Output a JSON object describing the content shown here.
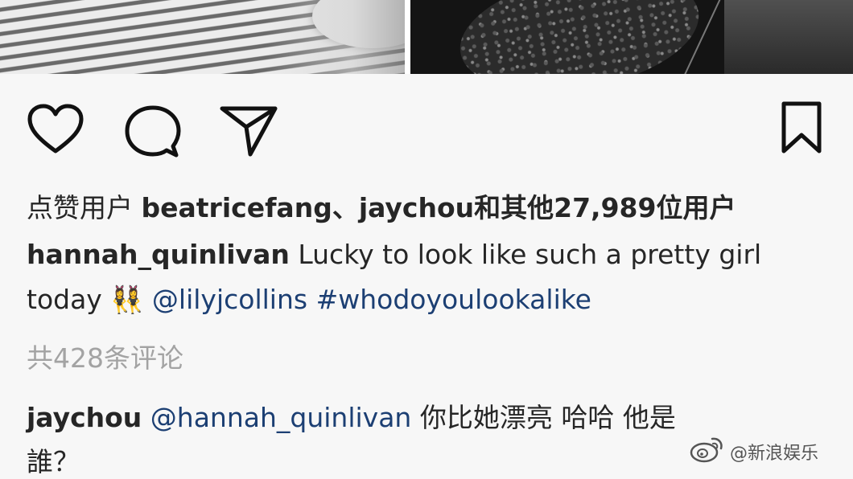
{
  "post": {
    "likes_line": {
      "prefix": "点赞用户",
      "users": "beatricefang、jaychou",
      "suffix": "和其他27,989位用户"
    },
    "caption": {
      "username": "hannah_quinlivan",
      "text_line1": "Lucky to look like such a pretty girl",
      "text_line2": "today",
      "emoji": "👯‍♀",
      "mention": "@lilyjcollins",
      "hashtag": "#whodoyoulookalike"
    },
    "comments_count": "共428条评论",
    "comment": {
      "username": "jaychou",
      "mention": "@hannah_quinlivan",
      "text_line1": "你比她漂亮 哈哈 他是",
      "text_line2": "誰？"
    }
  },
  "icons": {
    "like": "heart-icon",
    "comment": "comment-icon",
    "share": "send-icon",
    "save": "bookmark-icon",
    "watermark_logo": "weibo-icon"
  },
  "watermark": {
    "text": "@新浪娱乐"
  },
  "colors": {
    "text": "#262626",
    "link": "#1c3f73",
    "muted": "#a3a3a3",
    "background": "#f7f7f7"
  }
}
